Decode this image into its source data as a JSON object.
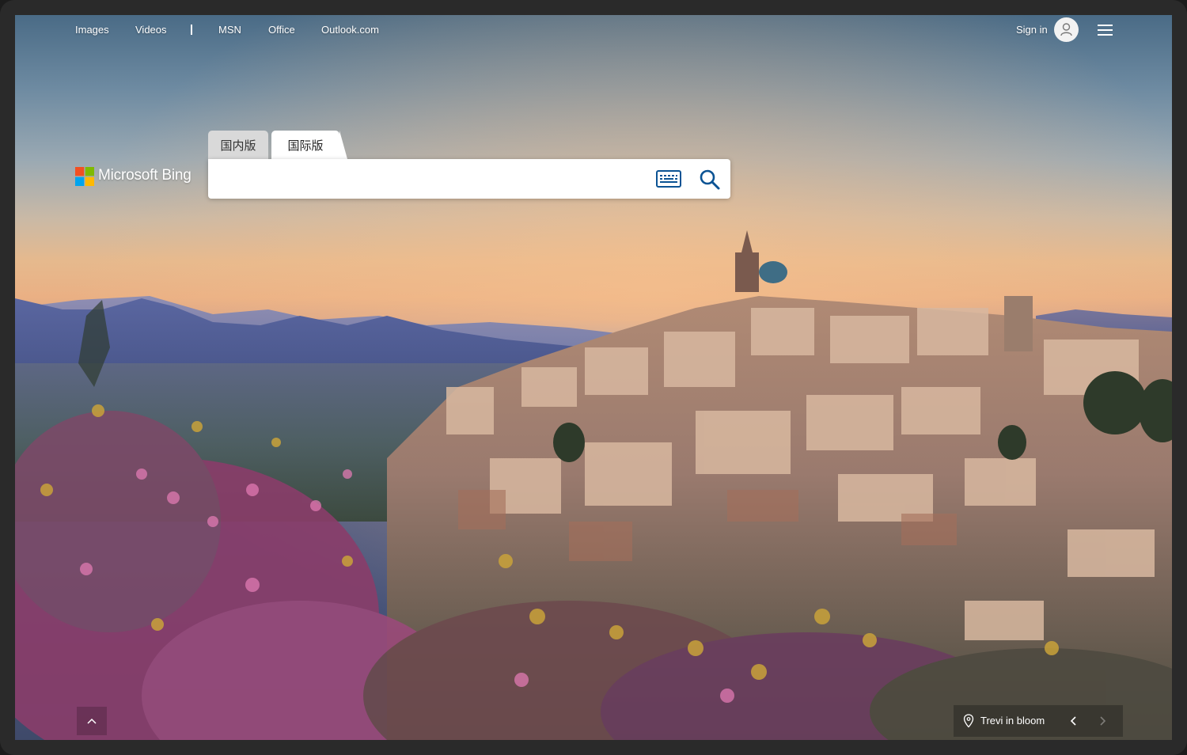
{
  "nav": {
    "links": [
      "Images",
      "Videos",
      "MSN",
      "Office",
      "Outlook.com"
    ],
    "sign_in_label": "Sign in"
  },
  "logo": {
    "text": "Microsoft Bing"
  },
  "tabs": [
    {
      "label": "国内版",
      "active": false
    },
    {
      "label": "国际版",
      "active": true
    }
  ],
  "search": {
    "value": "",
    "placeholder": ""
  },
  "icons": {
    "avatar": "person-icon",
    "menu": "hamburger-menu-icon",
    "keyboard": "keyboard-icon",
    "search": "search-icon",
    "scroll_up": "chevron-up-icon",
    "location": "location-pin-icon",
    "prev": "chevron-left-icon",
    "next": "chevron-right-icon"
  },
  "image_caption": {
    "title": "Trevi in bloom"
  },
  "colors": {
    "search_icon": "#0b5394",
    "keyboard_icon": "#0b5394",
    "logo_red": "#f25022",
    "logo_green": "#7fba00",
    "logo_blue": "#00a4ef",
    "logo_yellow": "#ffb900"
  }
}
